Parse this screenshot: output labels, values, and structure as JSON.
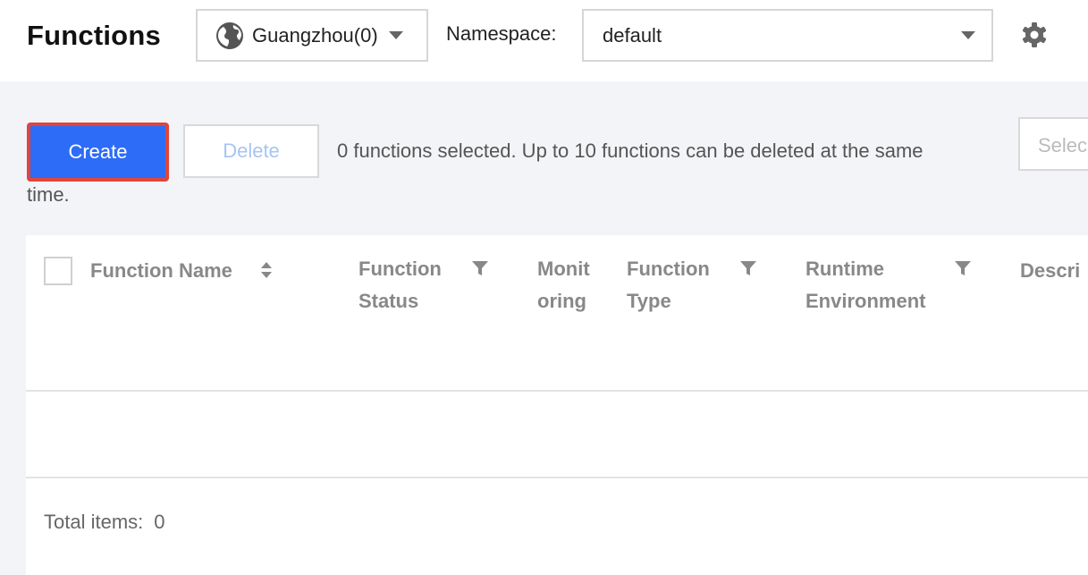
{
  "header": {
    "title": "Functions",
    "region": "Guangzhou(0)",
    "namespace_label": "Namespace:",
    "namespace_value": "default"
  },
  "toolbar": {
    "create_label": "Create",
    "delete_label": "Delete",
    "selection_info_line1": "0 functions selected. Up to 10 functions can be deleted at the same",
    "selection_info_line2": "time.",
    "search_placeholder": "Selec"
  },
  "table": {
    "columns": [
      "Function Name",
      "Function Status",
      "Monitoring",
      "Function Type",
      "Runtime Environment",
      "Descri"
    ],
    "rows": []
  },
  "footer": {
    "total_label": "Total items:",
    "total_value": "0"
  },
  "colors": {
    "primary": "#2d6cf7",
    "highlight_border": "#e0443a"
  }
}
